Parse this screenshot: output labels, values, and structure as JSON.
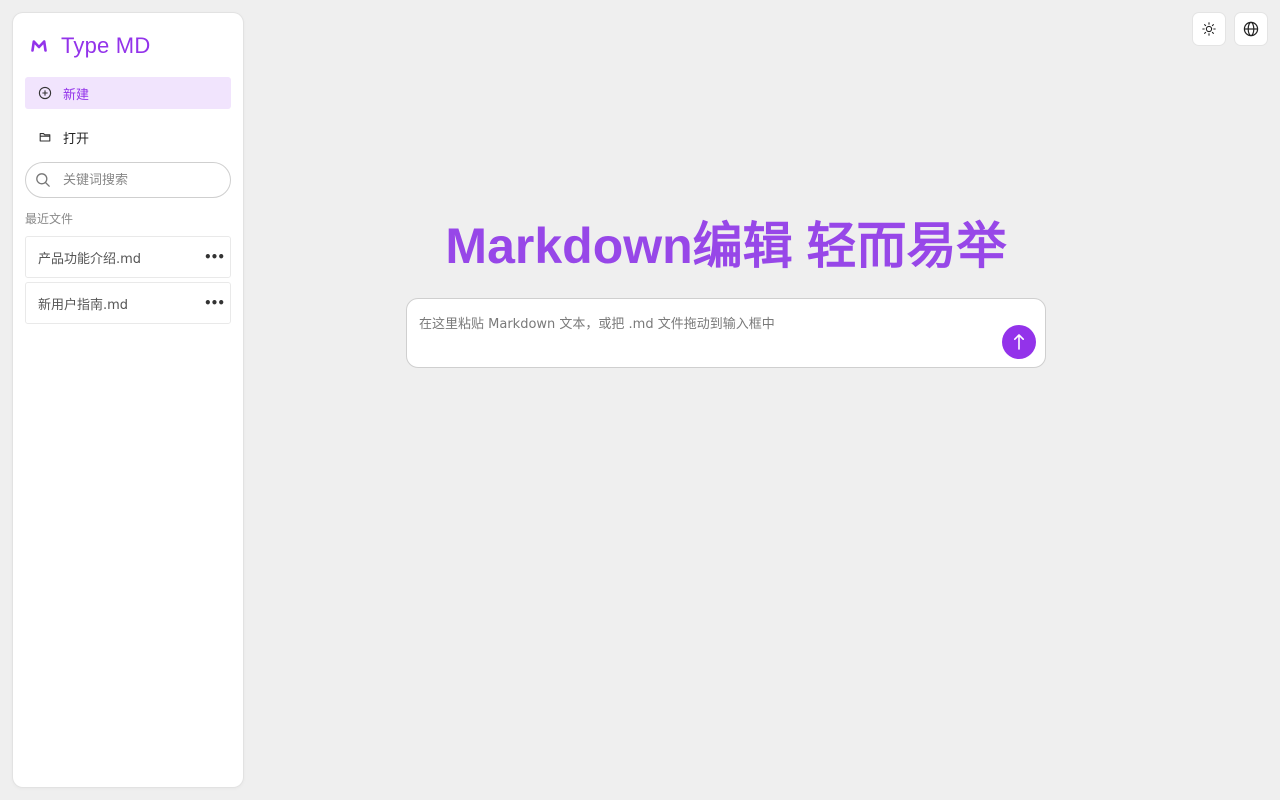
{
  "brand": {
    "name": "Type MD",
    "logo_icon": "markdown-m-logo",
    "accent": "#9333ea"
  },
  "sidebar": {
    "new_label": "新建",
    "open_label": "打开",
    "search": {
      "placeholder": "关键词搜索",
      "value": ""
    },
    "recent_label": "最近文件",
    "recent_files": [
      {
        "name": "产品功能介绍.md"
      },
      {
        "name": "新用户指南.md"
      }
    ]
  },
  "toolbar": {
    "theme_icon": "sun-icon",
    "language_icon": "globe-icon"
  },
  "main": {
    "title": "Markdown编辑 轻而易举",
    "input": {
      "placeholder": "在这里粘贴 Markdown 文本，或把 .md 文件拖动到输入框中",
      "value": ""
    },
    "send_icon": "arrow-up-icon"
  },
  "colors": {
    "accent": "#9333ea",
    "active_bg": "#f1e4fd",
    "page_bg": "#efefef"
  }
}
